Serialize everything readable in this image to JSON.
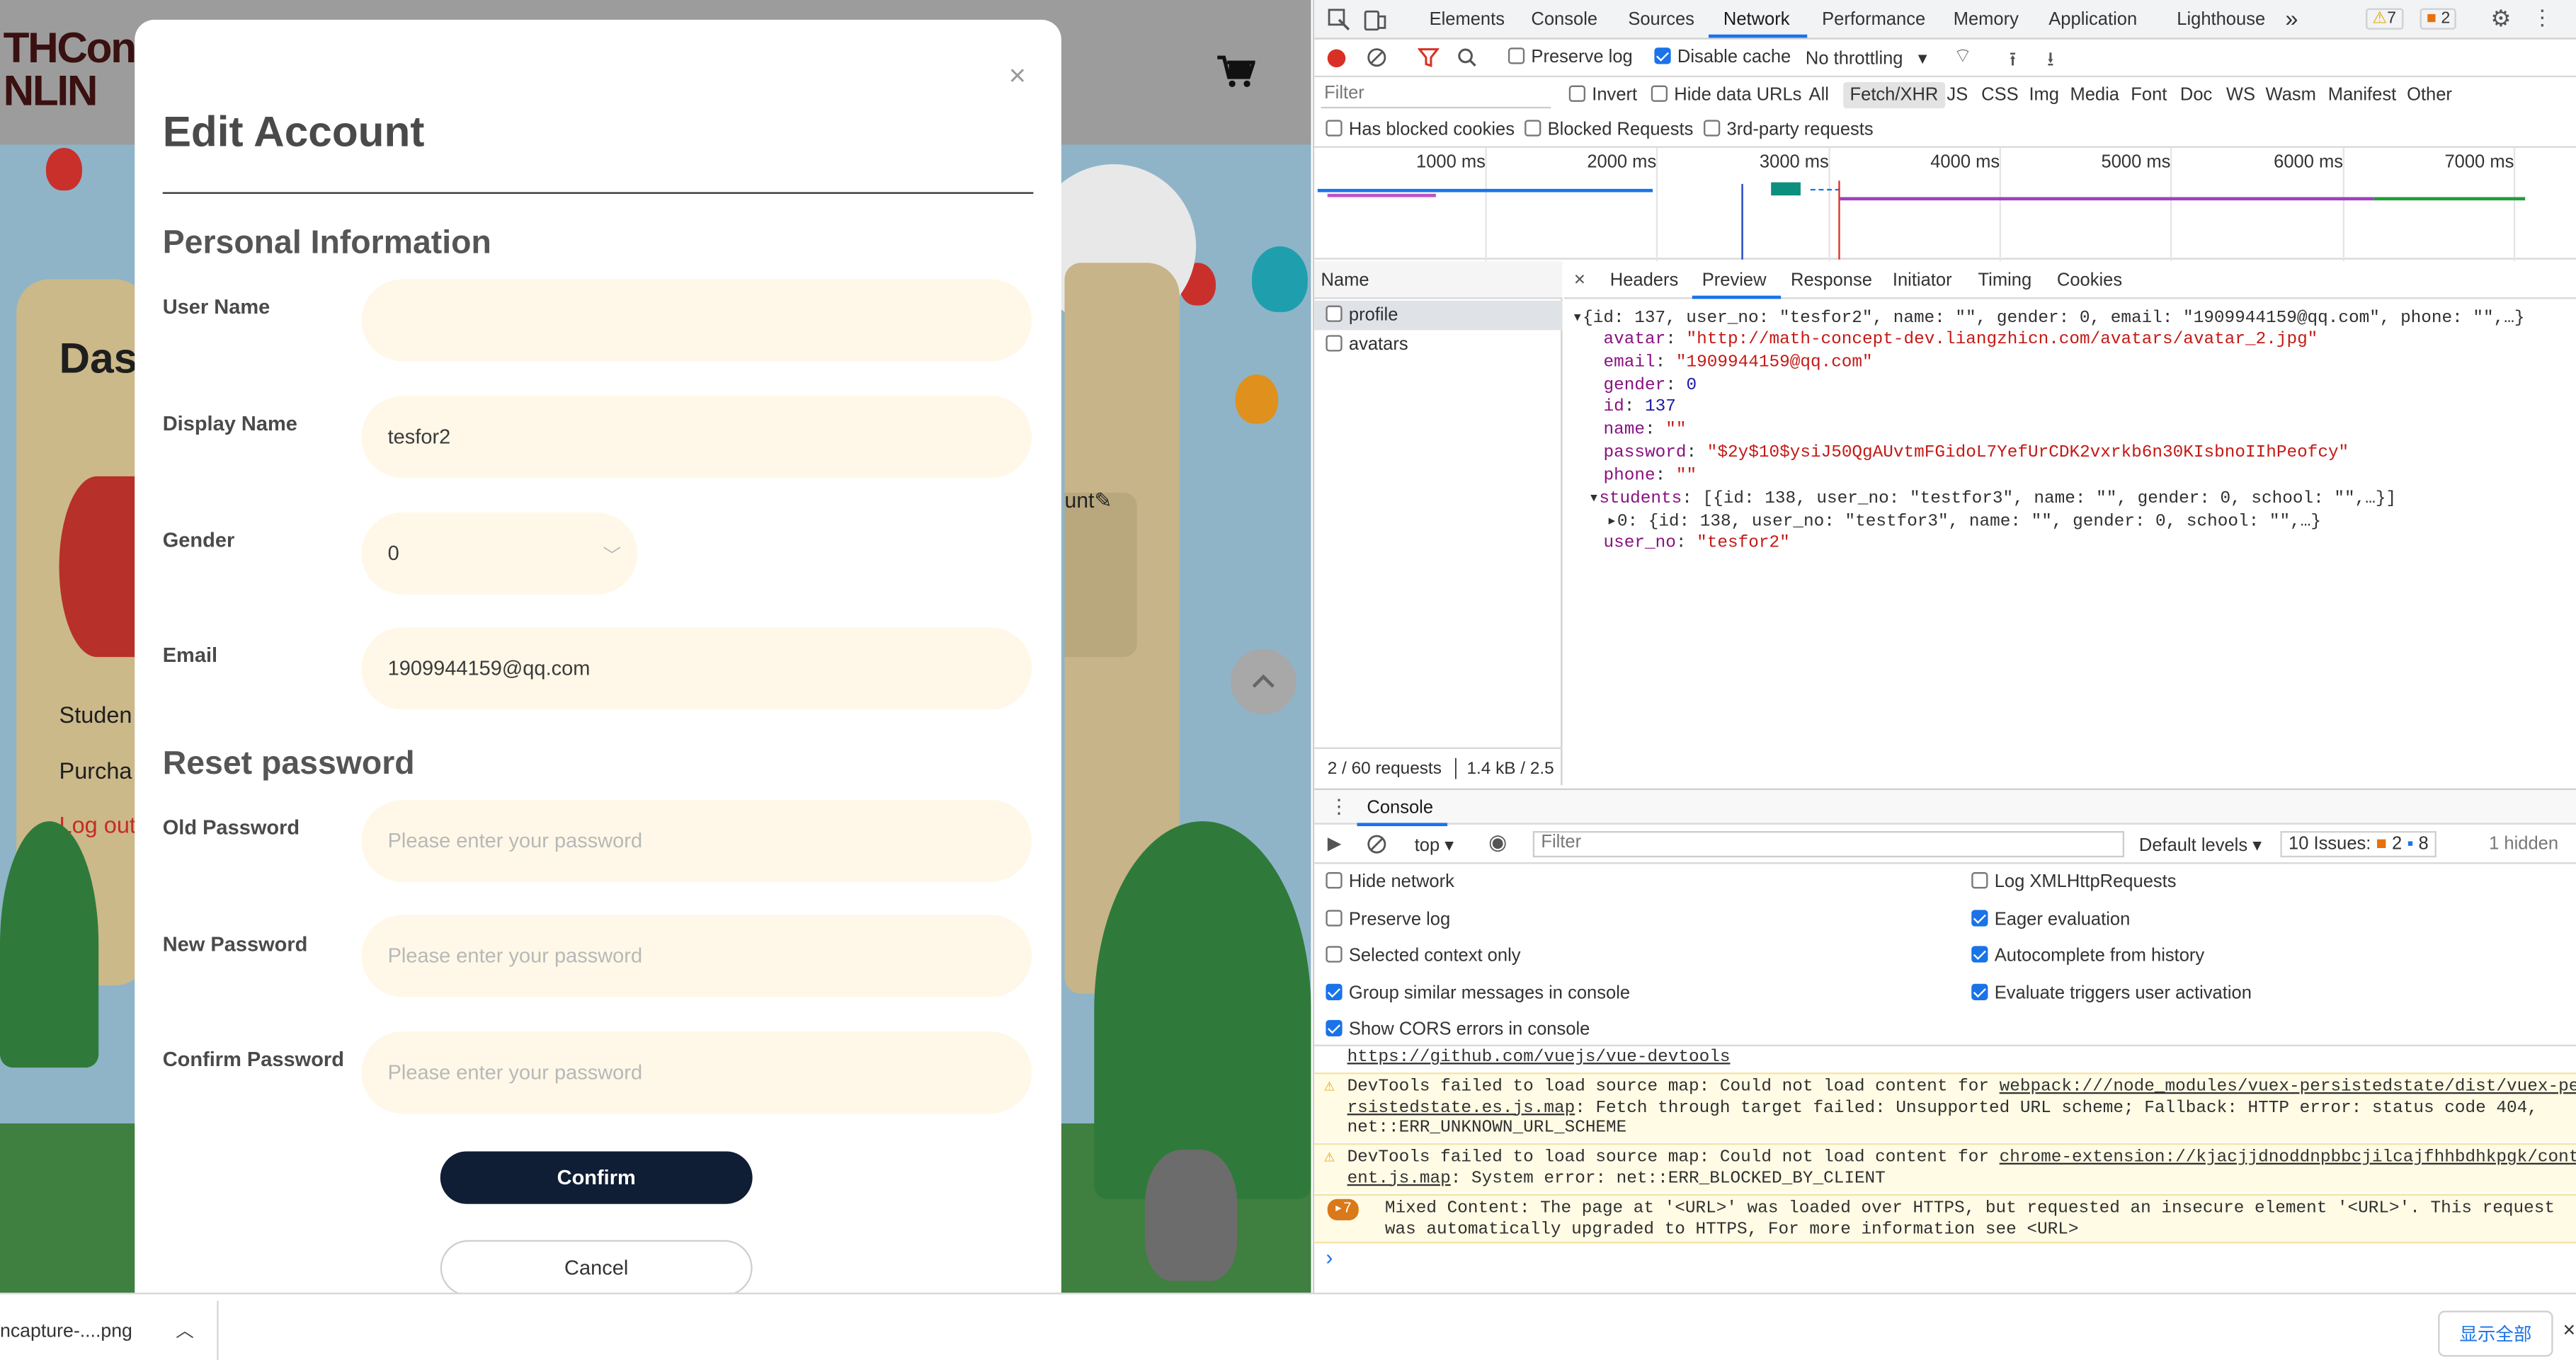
{
  "page": {
    "logo_top": "THCon",
    "logo_bottom": "NLIN",
    "dashboard_title": "Das",
    "side_links": [
      "Studen",
      "Purcha",
      "Log out"
    ],
    "account_edit_fragment": "unt"
  },
  "modal": {
    "title": "Edit Account",
    "close_glyph": "×",
    "section_personal": "Personal Information",
    "section_reset": "Reset password",
    "fields": {
      "username": {
        "label": "User Name",
        "value": ""
      },
      "display_name": {
        "label": "Display Name",
        "value": "tesfor2"
      },
      "gender": {
        "label": "Gender",
        "value": "0"
      },
      "email": {
        "label": "Email",
        "value": "1909944159@qq.com"
      },
      "old_password": {
        "label": "Old Password",
        "placeholder": "Please enter your password"
      },
      "new_password": {
        "label": "New Password",
        "placeholder": "Please enter your password"
      },
      "confirm_password": {
        "label": "Confirm Password",
        "placeholder": "Please enter your password"
      }
    },
    "confirm_label": "Confirm",
    "cancel_label": "Cancel"
  },
  "devtools": {
    "tabs": [
      "Elements",
      "Console",
      "Sources",
      "Network",
      "Performance",
      "Memory",
      "Application",
      "Lighthouse"
    ],
    "active_tab": "Network",
    "more_tabs": "»",
    "warn_count": "7",
    "issue_count": "2",
    "toolbar": {
      "preserve_log": "Preserve log",
      "disable_cache": "Disable cache",
      "throttling": "No throttling"
    },
    "filter_placeholder": "Filter",
    "filter_row": {
      "invert": "Invert",
      "hide_data_urls": "Hide data URLs",
      "types": [
        "All",
        "Fetch/XHR",
        "JS",
        "CSS",
        "Img",
        "Media",
        "Font",
        "Doc",
        "WS",
        "Wasm",
        "Manifest",
        "Other"
      ],
      "active_type": "Fetch/XHR"
    },
    "blocked_row": {
      "has_blocked_cookies": "Has blocked cookies",
      "blocked_requests": "Blocked Requests",
      "third_party": "3rd-party requests"
    },
    "timeline_labels": [
      "1000 ms",
      "2000 ms",
      "3000 ms",
      "4000 ms",
      "5000 ms",
      "6000 ms",
      "7000 ms"
    ],
    "name_header": "Name",
    "requests": [
      "profile",
      "avatars"
    ],
    "status_requests": "2 / 60 requests",
    "status_size": "1.4 kB / 2.5",
    "detail_tabs": [
      "Headers",
      "Preview",
      "Response",
      "Initiator",
      "Timing",
      "Cookies"
    ],
    "active_detail_tab": "Preview",
    "preview": {
      "summary": "{id: 137, user_no: \"tesfor2\", name: \"\", gender: 0, email: \"1909944159@qq.com\", phone: \"\",…}",
      "rows": [
        {
          "k": "avatar",
          "v": "\"http://math-concept-dev.liangzhicn.com/avatars/avatar_2.jpg\"",
          "t": "str"
        },
        {
          "k": "email",
          "v": "\"1909944159@qq.com\"",
          "t": "str"
        },
        {
          "k": "gender",
          "v": "0",
          "t": "num"
        },
        {
          "k": "id",
          "v": "137",
          "t": "num"
        },
        {
          "k": "name",
          "v": "\"\"",
          "t": "str"
        },
        {
          "k": "password",
          "v": "\"$2y$10$ysiJ50QgAUvtmFGidoL7YefUrCDK2vxrkb6n30KIsbnoIIhPeofcy\"",
          "t": "str"
        },
        {
          "k": "phone",
          "v": "\"\"",
          "t": "str"
        }
      ],
      "students_key": "students",
      "students_summary": "[{id: 138, user_no: \"testfor3\", name: \"\", gender: 0, school: \"\",…}]",
      "student_0": "0: {id: 138, user_no: \"testfor3\", name: \"\", gender: 0, school: \"\",…}",
      "user_no_key": "user_no",
      "user_no_val": "\"tesfor2\""
    },
    "console": {
      "tab_label": "Console",
      "context": "top",
      "filter_placeholder": "Filter",
      "levels": "Default levels",
      "issues_label": "10 Issues:",
      "issues_warn": "2",
      "issues_info": "8",
      "hidden": "1 hidden",
      "settings_left": [
        {
          "label": "Hide network",
          "checked": false
        },
        {
          "label": "Preserve log",
          "checked": false
        },
        {
          "label": "Selected context only",
          "checked": false
        },
        {
          "label": "Group similar messages in console",
          "checked": true
        },
        {
          "label": "Show CORS errors in console",
          "checked": true
        }
      ],
      "settings_right": [
        {
          "label": "Log XMLHttpRequests",
          "checked": false
        },
        {
          "label": "Eager evaluation",
          "checked": true
        },
        {
          "label": "Autocomplete from history",
          "checked": true
        },
        {
          "label": "Evaluate triggers user activation",
          "checked": true
        }
      ],
      "vue_link": "https://github.com/vuejs/vue-devtools",
      "msg1_a": "DevTools failed to load source map: Could not load content for ",
      "msg1_link1": "webpack:///node_modules/vuex-persistedstate/dist/vuex-pe",
      "msg1_link2": "rsistedstate.es.js.map",
      "msg1_b": ": Fetch through target failed: Unsupported URL scheme; Fallback: HTTP error: status code 404,",
      "msg1_c": "net::ERR_UNKNOWN_URL_SCHEME",
      "msg2_a": "DevTools failed to load source map: Could not load content for ",
      "msg2_link1": "chrome-extension://kjacjjdnoddnpbbcjilcajfhhbdhkpgk/cont",
      "msg2_link2": "ent.js.map",
      "msg2_b": ": System error: net::ERR_BLOCKED_BY_CLIENT",
      "msg3_count": "7",
      "msg3_a": "Mixed Content: The page at '<URL>' was loaded over HTTPS, but requested an insecure element '<URL>'. This request",
      "msg3_b": "was automatically upgraded to HTTPS, For more information see <URL>",
      "prompt": "›"
    }
  },
  "download_bar": {
    "file": "ncapture-....png",
    "show_all": "显示全部"
  }
}
